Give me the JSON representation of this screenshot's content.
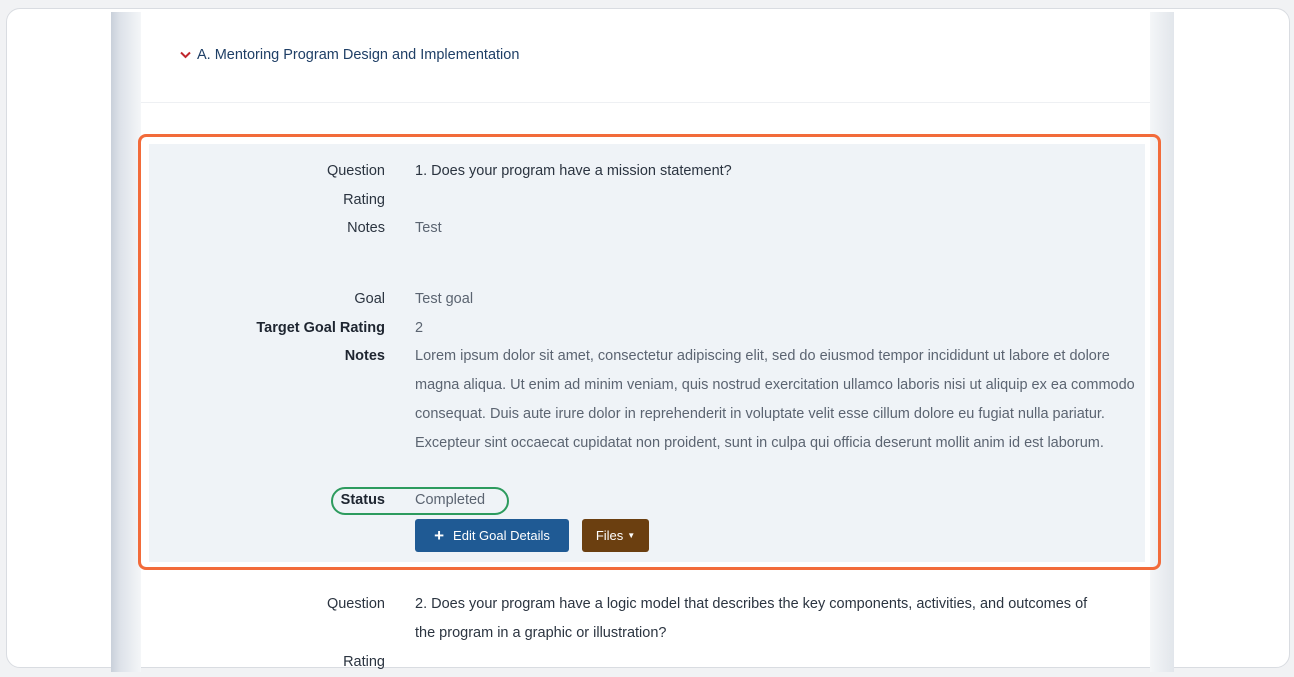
{
  "section": {
    "title": "A. Mentoring Program Design and Implementation",
    "chevron_icon": "chevron-down-icon"
  },
  "item1": {
    "question_label": "Question",
    "question": "1. Does your program have a mission statement?",
    "rating_label": "Rating",
    "rating": "",
    "notes_label": "Notes",
    "notes": "Test",
    "goal_label": "Goal",
    "goal": "Test goal",
    "target_label": "Target Goal Rating",
    "target": "2",
    "goal_notes_label": "Notes",
    "goal_notes": "Lorem ipsum dolor sit amet, consectetur adipiscing elit, sed do eiusmod tempor incididunt ut labore et dolore magna aliqua. Ut enim ad minim veniam, quis nostrud exercitation ullamco laboris nisi ut aliquip ex ea commodo consequat. Duis aute irure dolor in reprehenderit in voluptate velit esse cillum dolore eu fugiat nulla pariatur. Excepteur sint occaecat cupidatat non proident, sunt in culpa qui officia deserunt mollit anim id est laborum.",
    "status_label": "Status",
    "status": "Completed",
    "edit_button": "Edit Goal Details",
    "files_button": "Files"
  },
  "item2": {
    "question_label": "Question",
    "question_line1": "2. Does your program have a logic model that describes the key components, activities, and outcomes of",
    "question_line2": "the program in a graphic or illustration?",
    "rating_label": "Rating"
  },
  "colors": {
    "highlight": "#f26b3a",
    "status_oval": "#2d9b5e",
    "edit_button": "#1f5a94",
    "files_button": "#6b3f10",
    "header_text": "#1f3f66",
    "chevron": "#c0272d"
  }
}
